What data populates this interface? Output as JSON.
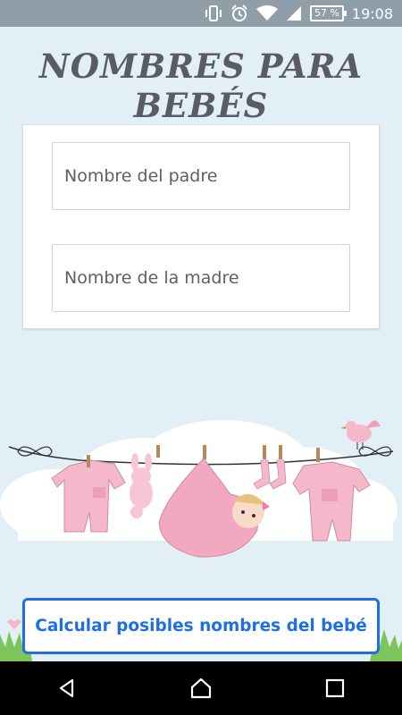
{
  "status_bar": {
    "icons": [
      "vibrate-icon",
      "alarm-icon",
      "wifi-icon",
      "signal-icon"
    ],
    "battery": "57 %",
    "time": "19:08"
  },
  "header": {
    "title": "NOMBRES PARA BEBÉS"
  },
  "form": {
    "father_placeholder": "Nombre del padre",
    "mother_placeholder": "Nombre de la madre",
    "father_value": "",
    "mother_value": ""
  },
  "actions": {
    "calculate_label": "Calcular posibles nombres del bebé"
  },
  "nav": {
    "icons": [
      "back-icon",
      "home-icon",
      "recents-icon"
    ]
  },
  "colors": {
    "background": "#e3eff7",
    "status_bar": "#8f9ea8",
    "accent": "#1d6fe3",
    "title": "#595b66",
    "pink": "#f5b8cb"
  }
}
